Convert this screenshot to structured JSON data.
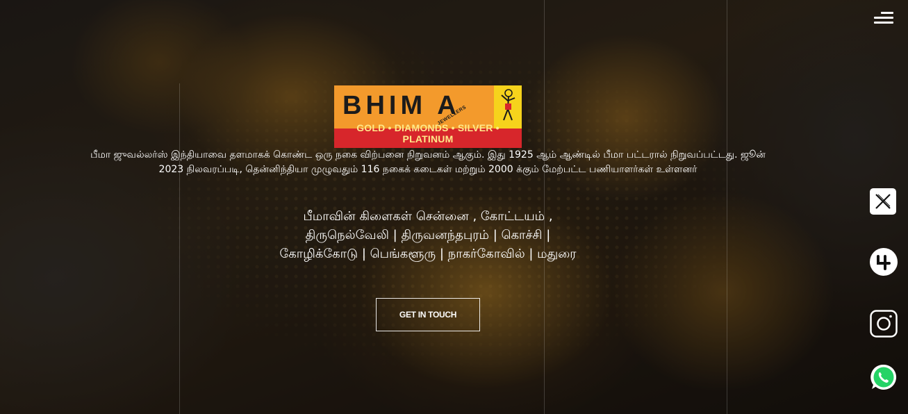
{
  "header": {
    "menu_icon": "hamburger-menu-icon"
  },
  "brand": {
    "logo_word": "BHIM A",
    "logo_tagline": "GOLD • DIAMONDS • SILVER • PLATINUM",
    "logo_stamp": "JEWELLERS",
    "colors": {
      "orange": "#f39a2c",
      "red": "#d7262b",
      "yellow": "#f6d31c"
    }
  },
  "hero": {
    "about_text": "பீமா ஜுவல்லர்ஸ் இந்தியாவை தளமாகக் கொண்ட ஒரு நகை விற்பனை நிறுவனம் ஆகும். இது 1925 ஆம் ஆண்டில் பீமா பட்டரால் நிறுவப்பட்டது. ஜூன் 2023 நிலவரப்படி, தென்னிந்தியா முழுவதும் 116 நகைக் கடைகள் மற்றும் 2000 க்கும் மேற்பட்ட பணியாளர்கள் உள்ளனர்",
    "branches_text": "பீமாவின் கிளைகள் சென்னை , கோட்டயம் , திருநெல்வேலி | திருவனந்தபுரம் | கொச்சி | கோழிக்கோடு | பெங்களூரு | நாகர்கோவில் | மதுரை",
    "cta_label": "GET IN TOUCH"
  },
  "social": [
    {
      "icon": "x-twitter-icon"
    },
    {
      "icon": "threads-icon"
    },
    {
      "icon": "instagram-icon"
    },
    {
      "icon": "whatsapp-icon",
      "color": "#25d366"
    }
  ]
}
